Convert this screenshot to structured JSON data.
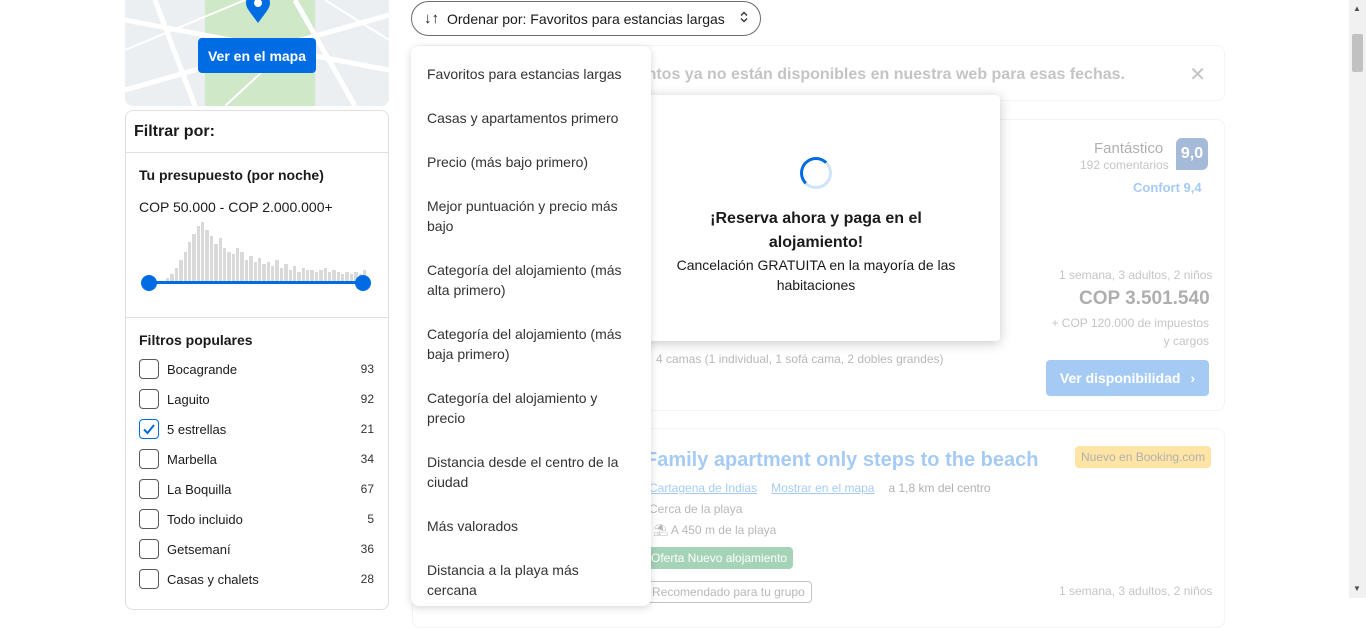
{
  "map": {
    "button_label": "Ver en el mapa"
  },
  "filters": {
    "title": "Filtrar por:",
    "budget_title": "Tu presupuesto (por noche)",
    "budget_range": "COP 50.000 - COP 2.000.000+",
    "slider_min_fraction": 0,
    "slider_max_fraction": 1,
    "popular_title": "Filtros populares",
    "items": [
      {
        "label": "Bocagrande",
        "count": "93",
        "checked": false
      },
      {
        "label": "Laguito",
        "count": "92",
        "checked": false
      },
      {
        "label": "5 estrellas",
        "count": "21",
        "checked": true
      },
      {
        "label": "Marbella",
        "count": "34",
        "checked": false
      },
      {
        "label": "La Boquilla",
        "count": "67",
        "checked": false
      },
      {
        "label": "Todo incluido",
        "count": "5",
        "checked": false
      },
      {
        "label": "Getsemaní",
        "count": "36",
        "checked": false
      },
      {
        "label": "Casas y chalets",
        "count": "28",
        "checked": false
      }
    ]
  },
  "sort": {
    "label": "Ordenar por: Favoritos para estancias largas",
    "options": [
      "Favoritos para estancias largas",
      "Casas y apartamentos primero",
      "Precio (más bajo primero)",
      "Mejor puntuación y precio más bajo",
      "Categoría del alojamiento (más alta primero)",
      "Categoría del alojamiento (más baja primero)",
      "Categoría del alojamiento y precio",
      "Distancia desde el centro de la ciudad",
      "Más valorados",
      "Distancia a la playa más cercana"
    ]
  },
  "notice": {
    "text": "mientos ya no están disponibles en nuestra web para esas fechas."
  },
  "card1": {
    "score_word": "Fantástico",
    "score_count": "192 comentarios",
    "score": "9,0",
    "comfort": "Confort 9,4",
    "stay": "1 semana, 3 adultos, 2 niños",
    "price": "COP 3.501.540",
    "taxes": "+ COP 120.000 de impuestos y cargos",
    "beds": "4 camas (1 individual, 1 sofá cama, 2 dobles grandes)",
    "button": "Ver disponibilidad"
  },
  "card2": {
    "title": "Family apartment only steps to the beach",
    "badge": "Nuevo en Booking.com",
    "city_link": "Cartagena de Indias",
    "map_link": "Mostrar en el mapa",
    "distance": "a 1,8 km del centro",
    "near": "Cerca de la playa",
    "beach": "A 450 m de la playa",
    "offer": "Oferta Nuevo alojamiento",
    "recommended": "Recomendado para tu grupo",
    "stay": "1 semana, 3 adultos, 2 niños"
  },
  "modal": {
    "title": "¡Reserva ahora y paga en el alojamiento!",
    "subtitle": "Cancelación GRATUITA en la mayoría de las habitaciones"
  },
  "colors": {
    "accent": "#006ce4",
    "score_badge": "#003b95",
    "offer": "#008234",
    "new_badge": "#ffb700"
  },
  "icons": [
    "map-pin-icon",
    "sort-arrows-icon",
    "chevron-updown-icon",
    "checkmark-icon",
    "close-icon",
    "chevron-right-icon",
    "spinner-icon",
    "beach-icon"
  ]
}
